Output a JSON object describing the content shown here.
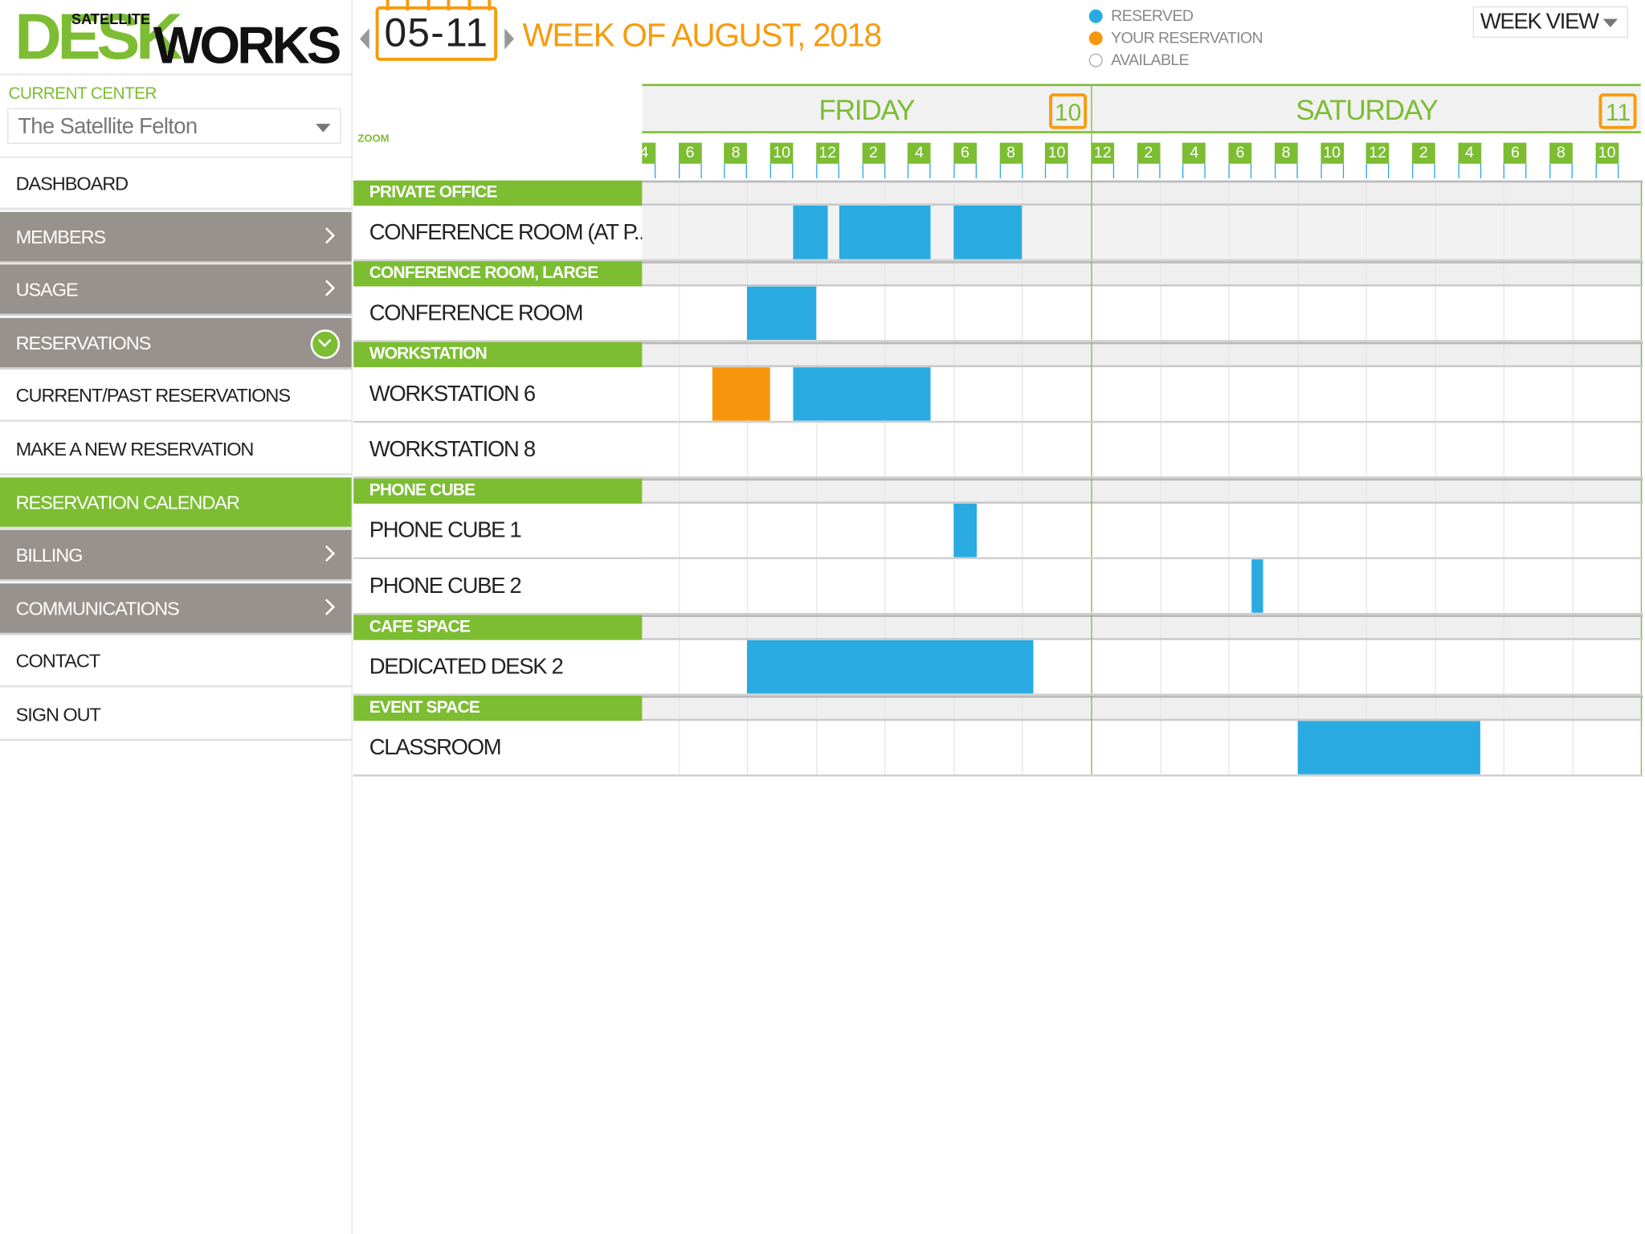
{
  "logo": {
    "top": "SATELLITE",
    "main_left": "DESK",
    "main_right": "WORKS"
  },
  "sidebar": {
    "current_center_label": "CURRENT CENTER",
    "current_center_value": "The Satellite Felton",
    "items": [
      {
        "label": "DASHBOARD",
        "style": "white"
      },
      {
        "label": "MEMBERS",
        "style": "grey",
        "icon": "chevron-right"
      },
      {
        "label": "USAGE",
        "style": "grey",
        "icon": "chevron-right"
      },
      {
        "label": "RESERVATIONS",
        "style": "grey",
        "icon": "chevron-down-circle"
      },
      {
        "label": "CURRENT/PAST RESERVATIONS",
        "style": "white"
      },
      {
        "label": "MAKE A NEW RESERVATION",
        "style": "white"
      },
      {
        "label": "RESERVATION CALENDAR",
        "style": "green",
        "active": true
      },
      {
        "label": "BILLING",
        "style": "grey",
        "icon": "chevron-right"
      },
      {
        "label": "COMMUNICATIONS",
        "style": "grey",
        "icon": "chevron-right"
      },
      {
        "label": "CONTACT",
        "style": "white"
      },
      {
        "label": "SIGN OUT",
        "style": "white"
      }
    ]
  },
  "header": {
    "date_range": "05-11",
    "week_title": "WEEK OF AUGUST, 2018",
    "view_select": "WEEK VIEW",
    "zoom_label": "ZOOM"
  },
  "legend": [
    {
      "label": "RESERVED",
      "color": "#29abe2"
    },
    {
      "label": "YOUR RESERVATION",
      "color": "#f7960d"
    },
    {
      "label": "AVAILABLE",
      "color": "#ffffff"
    }
  ],
  "colors": {
    "brand_green": "#7cbd32",
    "accent_orange": "#f79b0d",
    "reserved": "#29abe2",
    "yours": "#f7960d"
  },
  "days": [
    {
      "name": "FRIDAY",
      "date": "10"
    },
    {
      "name": "SATURDAY",
      "date": "11"
    }
  ],
  "hour_ticks": [
    "4",
    "6",
    "8",
    "10",
    "12",
    "2",
    "4",
    "6",
    "8",
    "10",
    "12",
    "2",
    "4",
    "6",
    "8",
    "10",
    "12",
    "2",
    "4",
    "6",
    "8",
    "10"
  ],
  "groups": [
    {
      "name": "PRIVATE OFFICE",
      "resources": [
        {
          "name": "CONFERENCE ROOM (AT P...",
          "reservations": [
            {
              "day": 0,
              "start": 11,
              "end": 12.5,
              "type": "reserved"
            },
            {
              "day": 0,
              "start": 13,
              "end": 17,
              "type": "reserved"
            },
            {
              "day": 0,
              "start": 18,
              "end": 21,
              "type": "reserved"
            }
          ]
        }
      ]
    },
    {
      "name": "CONFERENCE ROOM, LARGE",
      "resources": [
        {
          "name": "CONFERENCE ROOM",
          "reservations": [
            {
              "day": 0,
              "start": 9,
              "end": 12,
              "type": "reserved"
            }
          ]
        }
      ]
    },
    {
      "name": "WORKSTATION",
      "resources": [
        {
          "name": "WORKSTATION 6",
          "reservations": [
            {
              "day": 0,
              "start": 7.5,
              "end": 10,
              "type": "yours"
            },
            {
              "day": 0,
              "start": 11,
              "end": 17,
              "type": "reserved"
            }
          ]
        },
        {
          "name": "WORKSTATION 8",
          "reservations": []
        }
      ]
    },
    {
      "name": "PHONE CUBE",
      "resources": [
        {
          "name": "PHONE CUBE 1",
          "reservations": [
            {
              "day": 0,
              "start": 18,
              "end": 19,
              "type": "reserved"
            }
          ]
        },
        {
          "name": "PHONE CUBE 2",
          "reservations": [
            {
              "day": 1,
              "start": 7,
              "end": 7.5,
              "type": "reserved"
            }
          ]
        }
      ]
    },
    {
      "name": "CAFE SPACE",
      "resources": [
        {
          "name": "DEDICATED DESK 2",
          "reservations": [
            {
              "day": 0,
              "start": 9,
              "end": 21.5,
              "type": "reserved"
            }
          ]
        }
      ]
    },
    {
      "name": "EVENT SPACE",
      "resources": [
        {
          "name": "CLASSROOM",
          "reservations": [
            {
              "day": 1,
              "start": 9,
              "end": 17,
              "type": "reserved"
            }
          ]
        }
      ]
    }
  ]
}
